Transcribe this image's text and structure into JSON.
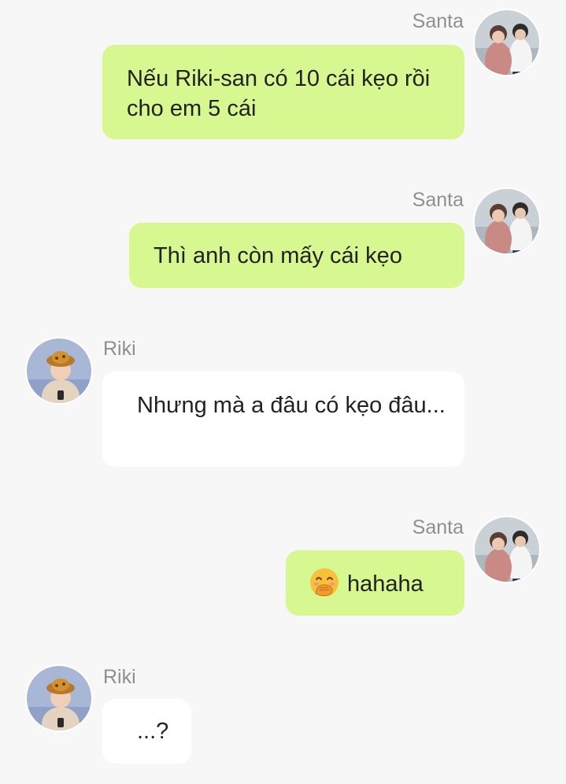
{
  "messages": [
    {
      "sender": "Santa",
      "side": "right",
      "avatar": "santa-avatar",
      "text": "Nếu Riki-san có 10 cái kẹo rồi cho em 5 cái"
    },
    {
      "sender": "Santa",
      "side": "right",
      "avatar": "santa-avatar",
      "text": "Thì anh còn mấy cái kẹo"
    },
    {
      "sender": "Riki",
      "side": "left",
      "avatar": "riki-avatar",
      "text": "Nhưng mà a đâu có kẹo đâu..."
    },
    {
      "sender": "Santa",
      "side": "right",
      "avatar": "santa-avatar",
      "emoji": "hand-over-mouth-emoji",
      "text": "hahaha"
    },
    {
      "sender": "Riki",
      "side": "left",
      "avatar": "riki-avatar",
      "text": "...?"
    }
  ],
  "colors": {
    "background": "#f7f7f7",
    "sent_bubble": "#d7f791",
    "received_bubble": "#ffffff",
    "name_text": "#8f8f8f",
    "message_text": "#222222"
  }
}
